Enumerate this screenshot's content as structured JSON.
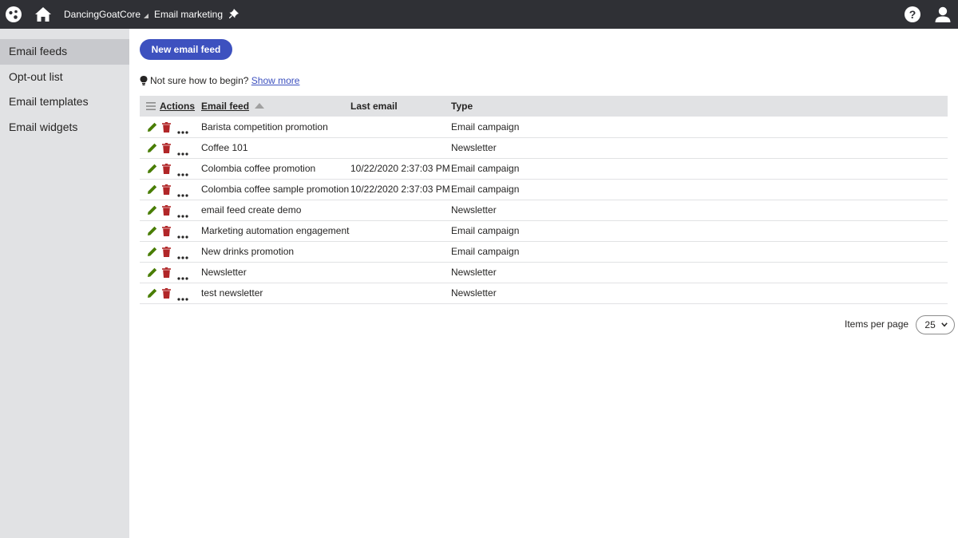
{
  "topbar": {
    "site_name": "DancingGoatCore",
    "app_name": "Email marketing",
    "icons": [
      "kentico-logo-icon",
      "home-icon",
      "help-icon",
      "user-icon",
      "pin-icon"
    ]
  },
  "sidebar": {
    "items": [
      {
        "label": "Email feeds",
        "active": true
      },
      {
        "label": "Opt-out list",
        "active": false
      },
      {
        "label": "Email templates",
        "active": false
      },
      {
        "label": "Email widgets",
        "active": false
      }
    ]
  },
  "main": {
    "new_button_label": "New email feed",
    "hint_text": "Not sure how to begin?",
    "hint_link": "Show more"
  },
  "grid": {
    "columns": {
      "actions": "Actions",
      "feed": "Email feed",
      "last": "Last email",
      "type": "Type"
    },
    "rows": [
      {
        "feed": "Barista competition promotion",
        "last": "",
        "type": "Email campaign"
      },
      {
        "feed": "Coffee 101",
        "last": "",
        "type": "Newsletter"
      },
      {
        "feed": "Colombia coffee promotion",
        "last": "10/22/2020 2:37:03 PM",
        "type": "Email campaign"
      },
      {
        "feed": "Colombia coffee sample promotion",
        "last": "10/22/2020 2:37:03 PM",
        "type": "Email campaign"
      },
      {
        "feed": "email feed create demo",
        "last": "",
        "type": "Newsletter"
      },
      {
        "feed": "Marketing automation engagement",
        "last": "",
        "type": "Email campaign"
      },
      {
        "feed": "New drinks promotion",
        "last": "",
        "type": "Email campaign"
      },
      {
        "feed": "Newsletter",
        "last": "",
        "type": "Newsletter"
      },
      {
        "feed": "test newsletter",
        "last": "",
        "type": "Newsletter"
      }
    ]
  },
  "pager": {
    "label": "Items per page",
    "value": "25"
  },
  "colors": {
    "topbar": "#2f3035",
    "sidebar": "#e1e2e4",
    "sidebar_active": "#c8c9cd",
    "accent": "#3d51bf",
    "edit_icon": "#497d04",
    "delete_icon": "#b12628"
  }
}
